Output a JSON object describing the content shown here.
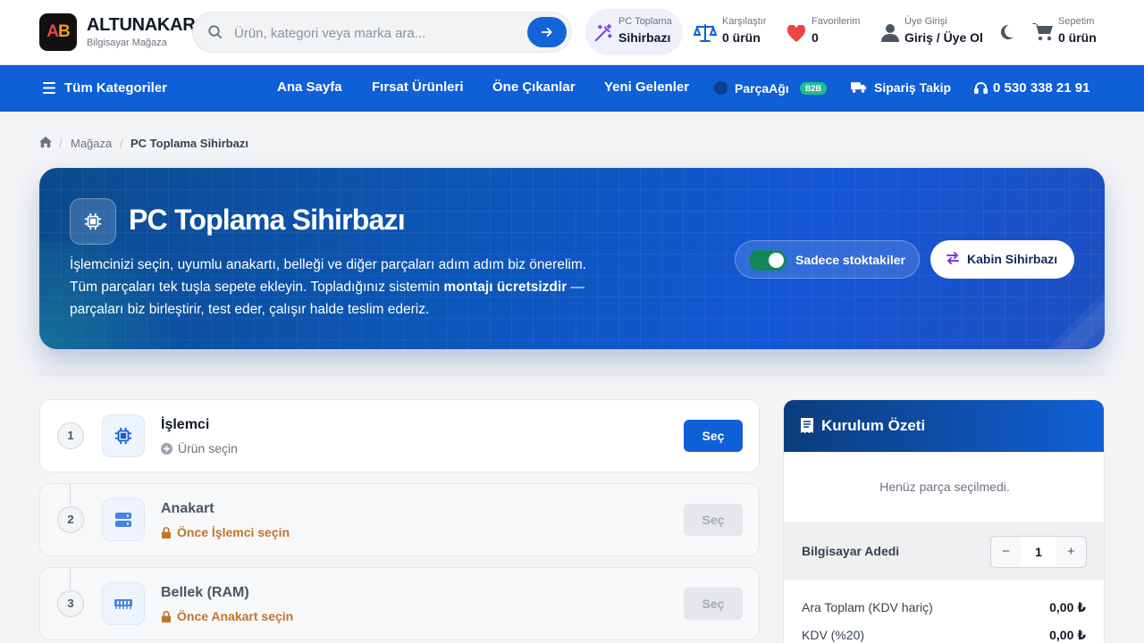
{
  "brand": {
    "logo_a": "A",
    "logo_b": "B",
    "name": "ALTUNAKAR",
    "tagline": "Bilgisayar Mağaza"
  },
  "search": {
    "placeholder": "Ürün, kategori veya marka ara..."
  },
  "header": {
    "wizard": {
      "top": "PC Toplama",
      "bottom": "Sihirbazı"
    },
    "compare": {
      "top": "Karşılaştır",
      "bottom": "0 ürün"
    },
    "favorites": {
      "top": "Favorilerim",
      "bottom": "0"
    },
    "account": {
      "top": "Üye Girişi",
      "bottom": "Giriş / Üye Ol"
    },
    "cart": {
      "top": "Sepetim",
      "bottom": "0 ürün"
    }
  },
  "nav": {
    "all_categories": "Tüm Kategoriler",
    "items": [
      "Ana Sayfa",
      "Fırsat Ürünleri",
      "Öne Çıkanlar",
      "Yeni Gelenler"
    ],
    "parcaagi": "ParçaAğı",
    "b2b": "B2B",
    "order_track": "Sipariş Takip",
    "phone": "0 530 338 21 91"
  },
  "breadcrumb": {
    "home_icon": "home-icon",
    "shop": "Mağaza",
    "current": "PC Toplama Sihirbazı"
  },
  "hero": {
    "title": "PC Toplama Sihirbazı",
    "line1": "İşlemcinizi seçin, uyumlu anakartı, belleği ve diğer parçaları adım adım biz önerelim.",
    "line2a": "Tüm parçaları tek tuşla sepete ekleyin. Topladığınız sistemin ",
    "line2b": "montajı ücretsizdir",
    "line2c": " —",
    "line3": "parçaları biz birleştirir, test eder, çalışır halde teslim ederiz.",
    "stock_toggle_label": "Sadece stoktakiler",
    "stock_toggle_on": true,
    "cabinet_button": "Kabin Sihirbazı"
  },
  "steps": [
    {
      "num": "1",
      "title": "İşlemci",
      "sub": "Ürün seçin",
      "button": "Seç",
      "locked": false
    },
    {
      "num": "2",
      "title": "Anakart",
      "sub": "Önce İşlemci seçin",
      "button": "Seç",
      "locked": true
    },
    {
      "num": "3",
      "title": "Bellek (RAM)",
      "sub": "Önce Anakart seçin",
      "button": "Seç",
      "locked": true
    }
  ],
  "summary": {
    "title": "Kurulum Özeti",
    "empty": "Henüz parça seçilmedi.",
    "qty_label": "Bilgisayar Adedi",
    "qty_minus": "−",
    "qty_value": "1",
    "qty_plus": "+",
    "subtotal_label": "Ara Toplam (KDV hariç)",
    "subtotal_value": "0,00 ₺",
    "vat_label": "KDV (%20)",
    "vat_value": "0,00 ₺"
  },
  "colors": {
    "primary": "#0f5fd6",
    "navbar": "#0f5fd6",
    "toggle_on": "#14875a",
    "lock_text": "#c2742b",
    "favorite": "#ef4444"
  }
}
